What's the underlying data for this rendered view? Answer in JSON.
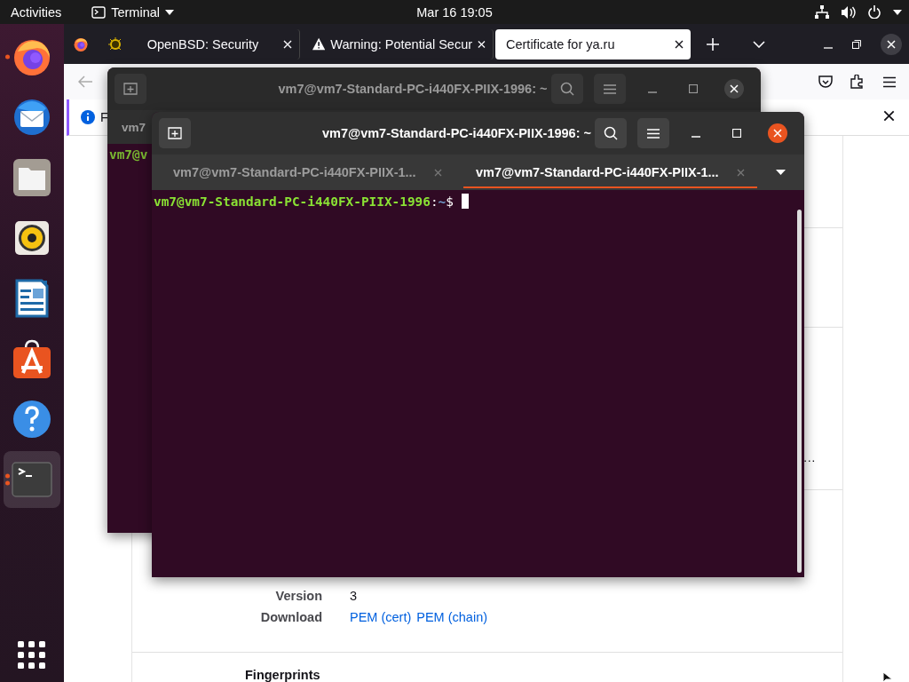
{
  "top_bar": {
    "activities": "Activities",
    "app_menu": "Terminal",
    "clock": "Mar 16  19:05"
  },
  "dock": {
    "items": [
      {
        "kind": "firefox",
        "running": true,
        "multiple_windows": false,
        "selected": false
      },
      {
        "kind": "thunderbird",
        "running": false,
        "multiple_windows": false,
        "selected": false
      },
      {
        "kind": "files",
        "running": false,
        "multiple_windows": false,
        "selected": false
      },
      {
        "kind": "rhythmbox",
        "running": false,
        "multiple_windows": false,
        "selected": false
      },
      {
        "kind": "writer",
        "running": false,
        "multiple_windows": false,
        "selected": false
      },
      {
        "kind": "software",
        "running": false,
        "multiple_windows": false,
        "selected": false
      },
      {
        "kind": "help",
        "running": false,
        "multiple_windows": false,
        "selected": false
      },
      {
        "kind": "terminal",
        "running": true,
        "multiple_windows": true,
        "selected": true
      }
    ]
  },
  "browser": {
    "tabs": [
      {
        "kind": "puffer",
        "title": "OpenBSD: Security",
        "selected": false
      },
      {
        "kind": "warning",
        "title": "Warning: Potential Secur",
        "selected": false
      },
      {
        "kind": "plain",
        "title": "Certificate for ya.ru",
        "selected": true
      }
    ],
    "notification": {
      "text": "F"
    },
    "page": {
      "truncated_value": "…",
      "rows": [
        {
          "label": "Version",
          "values": [
            {
              "text": "3",
              "link": false
            }
          ]
        },
        {
          "label": "Download",
          "values": [
            {
              "text": "PEM (cert)",
              "link": true
            },
            {
              "text": "PEM (chain)",
              "link": true
            }
          ]
        }
      ],
      "next_section": "Fingerprints"
    }
  },
  "terminal_back": {
    "title": "vm7@vm7-Standard-PC-i440FX-PIIX-1996: ~",
    "tab_label": "vm7",
    "prompt": "vm7@v",
    "active": false
  },
  "terminal_front": {
    "title": "vm7@vm7-Standard-PC-i440FX-PIIX-1996: ~",
    "active": true,
    "tabs": [
      {
        "label": "vm7@vm7-Standard-PC-i440FX-PIIX-1...",
        "selected": false
      },
      {
        "label": "vm7@vm7-Standard-PC-i440FX-PIIX-1...",
        "selected": true
      }
    ],
    "prompt": {
      "user_host": "vm7@vm7-Standard-PC-i440FX-PIIX-1996",
      "separator": ":",
      "path": "~",
      "symbol": "$"
    }
  }
}
